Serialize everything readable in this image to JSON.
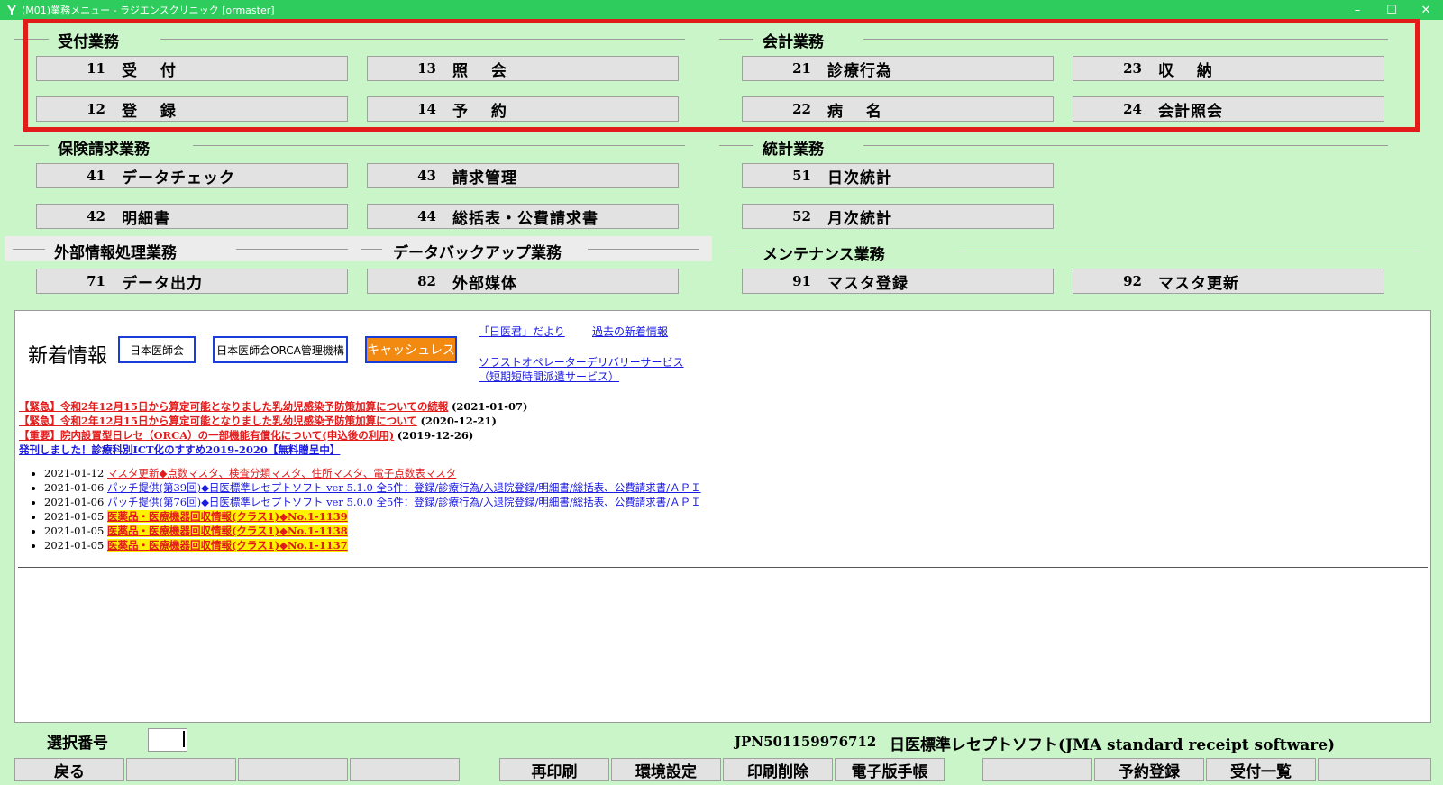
{
  "window": {
    "title": "(M01)業務メニュー - ラジエンスクリニック [ormaster]",
    "minimize": "–",
    "maximize": "☐",
    "close": "✕"
  },
  "sections": {
    "reception": "受付業務",
    "accounting": "会計業務",
    "insurance": "保険請求業務",
    "statistics": "統計業務",
    "external": "外部情報処理業務",
    "backup": "データバックアップ業務",
    "maintenance": "メンテナンス業務"
  },
  "menu": {
    "b11": {
      "num": "11",
      "label": "受　 付"
    },
    "b13": {
      "num": "13",
      "label": "照　 会"
    },
    "b21": {
      "num": "21",
      "label": "診療行為"
    },
    "b23": {
      "num": "23",
      "label": "収　 納"
    },
    "b12": {
      "num": "12",
      "label": "登　 録"
    },
    "b14": {
      "num": "14",
      "label": "予　 約"
    },
    "b22": {
      "num": "22",
      "label": "病　 名"
    },
    "b24": {
      "num": "24",
      "label": "会計照会"
    },
    "b41": {
      "num": "41",
      "label": "データチェック"
    },
    "b43": {
      "num": "43",
      "label": "請求管理"
    },
    "b51": {
      "num": "51",
      "label": "日次統計"
    },
    "b42": {
      "num": "42",
      "label": "明細書"
    },
    "b44": {
      "num": "44",
      "label": "総括表・公費請求書"
    },
    "b52": {
      "num": "52",
      "label": "月次統計"
    },
    "b71": {
      "num": "71",
      "label": "データ出力"
    },
    "b82": {
      "num": "82",
      "label": "外部媒体"
    },
    "b91": {
      "num": "91",
      "label": "マスタ登録"
    },
    "b92": {
      "num": "92",
      "label": "マスタ更新"
    }
  },
  "news": {
    "heading": "新着情報",
    "logo_jma": "日本医師会",
    "logo_orca": "日本医師会ORCA管理機構",
    "logo_cashless": "キャッシュレス",
    "link_dayori": "「日医君」だより",
    "link_past": "過去の新着情報",
    "link_solast1": "ソラストオペレーターデリバリーサービス",
    "link_solast2": "（短期短時間派遣サービス）",
    "alerts": [
      {
        "text": "【緊急】令和2年12月15日から算定可能となりました乳幼児感染予防策加算についての続報",
        "date": "(2021-01-07)"
      },
      {
        "text": "【緊急】令和2年12月15日から算定可能となりました乳幼児感染予防策加算について",
        "date": "(2020-12-21)"
      },
      {
        "text": "【重要】院内設置型日レセ（ORCA）の一部機能有償化について(申込後の利用)",
        "date": "(2019-12-26)"
      },
      {
        "text": "発刊しました！診療科別ICT化のすすめ2019-2020【無料贈呈中】",
        "date": ""
      }
    ],
    "items": [
      {
        "date": "2021-01-12",
        "text": "マスタ更新◆点数マスタ、検査分類マスタ、住所マスタ、電子点数表マスタ"
      },
      {
        "date": "2021-01-06",
        "text": "パッチ提供(第39回)◆日医標準レセプトソフト ver 5.1.0 全5件：登録/診療行為/入退院登録/明細書/総括表、公費請求書/ＡＰＩ"
      },
      {
        "date": "2021-01-06",
        "text": "パッチ提供(第76回)◆日医標準レセプトソフト ver 5.0.0 全5件：登録/診療行為/入退院登録/明細書/総括表、公費請求書/ＡＰＩ"
      },
      {
        "date": "2021-01-05",
        "text": "医薬品・医療機器回収情報(クラス1)◆No.1-1139"
      },
      {
        "date": "2021-01-05",
        "text": "医薬品・医療機器回収情報(クラス1)◆No.1-1138"
      },
      {
        "date": "2021-01-05",
        "text": "医薬品・医療機器回収情報(クラス1)◆No.1-1137"
      }
    ]
  },
  "footer": {
    "select_label": "選択番号",
    "select_value": "",
    "jpn": "JPN501159976712",
    "product": "日医標準レセプトソフト(JMA standard receipt software)",
    "buttons": {
      "back": "戻る",
      "reprint": "再印刷",
      "env": "環境設定",
      "printdel": "印刷削除",
      "ehandbook": "電子版手帳",
      "reserve": "予約登録",
      "reclist": "受付一覧"
    }
  }
}
